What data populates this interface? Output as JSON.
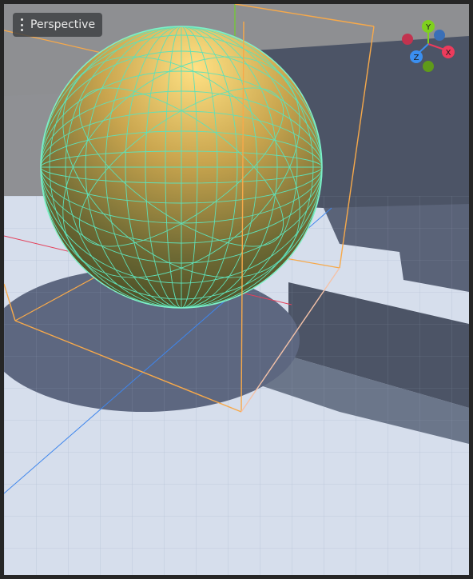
{
  "viewport": {
    "view_menu_label": "Perspective"
  },
  "gizmo": {
    "axes": [
      {
        "label": "Y",
        "color": "#7fd11e"
      },
      {
        "label": "Z",
        "color": "#3b8ff0"
      },
      {
        "label": "X",
        "color": "#ec3b5c"
      }
    ],
    "negative_colors": {
      "x": "#c2334f",
      "y": "#5f9a1a",
      "z": "#3a6fb7"
    }
  },
  "colors": {
    "wireframe": "#5fe0b8",
    "bounding_box": "#f7a94a",
    "floor": "#d6deec",
    "walls": "#4c5466",
    "sky": "#8f9094",
    "sphere_highlight": "#ffe183",
    "sphere_shadow": "#3b4421"
  }
}
